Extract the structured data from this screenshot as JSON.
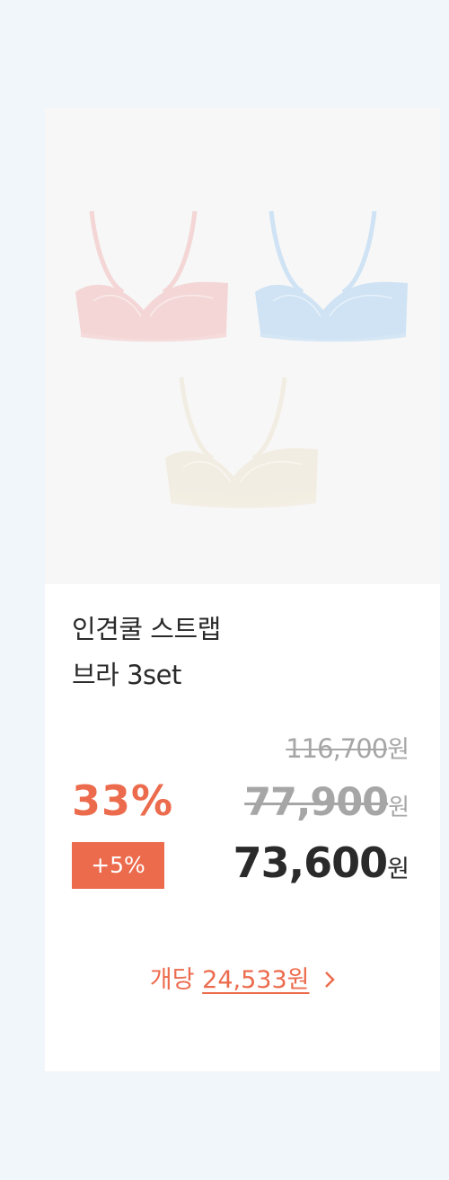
{
  "product": {
    "title_line1": "인견쿨 스트랩",
    "title_line2": "브라 3set",
    "image_colors": [
      "#f4d6d6",
      "#cfe3f4",
      "#f2ede2"
    ]
  },
  "pricing": {
    "original_price": "116,700",
    "discount_percent": "33%",
    "sale_price": "77,900",
    "extra_discount_badge": "+5%",
    "final_price": "73,600",
    "currency": "원"
  },
  "per_unit": {
    "prefix": "개당",
    "amount": "24,533원",
    "icon": "chevron-right-icon"
  },
  "colors": {
    "accent": "#ec6b4d",
    "background": "#f1f6fa"
  }
}
